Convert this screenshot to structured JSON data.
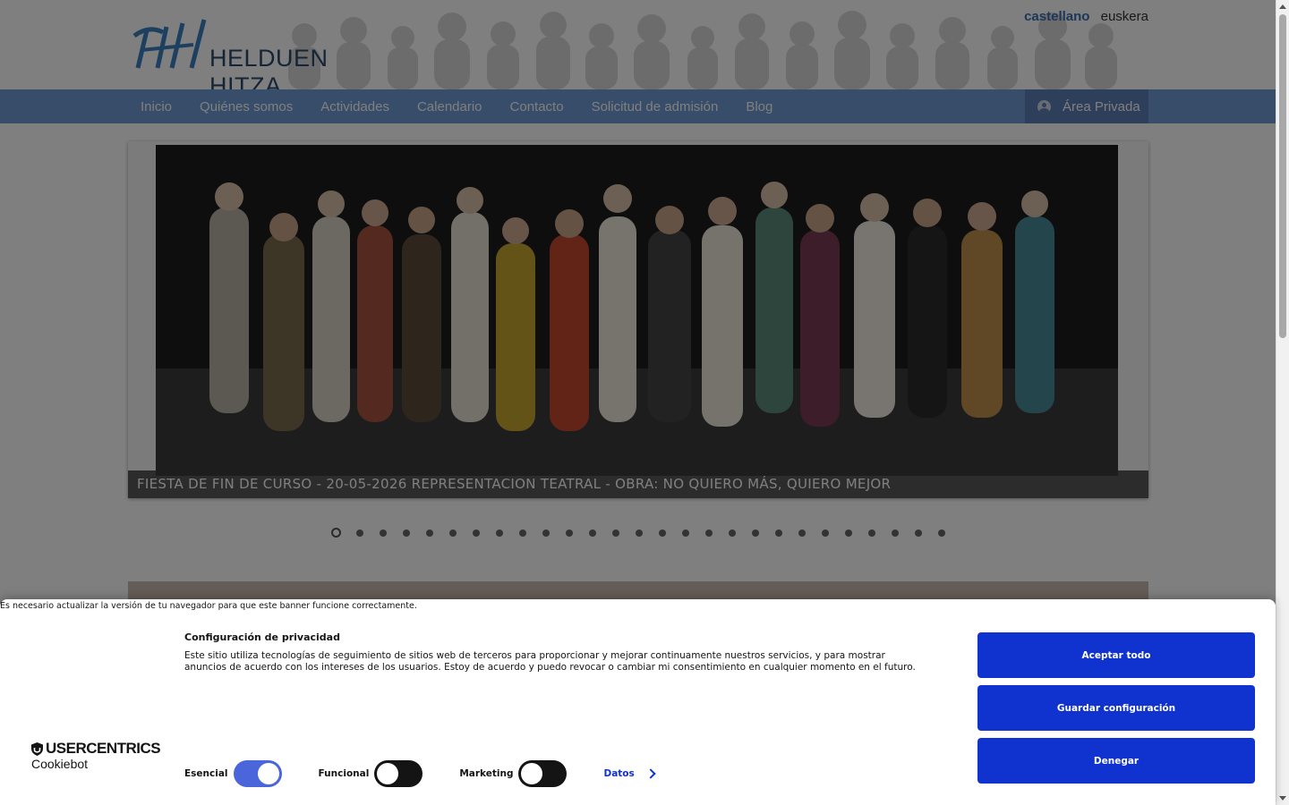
{
  "lang": {
    "active": "castellano",
    "other": "euskera"
  },
  "logo": {
    "text": "HELDUEN HITZA"
  },
  "nav": {
    "items": [
      "Inicio",
      "Quiénes somos",
      "Actividades",
      "Calendario",
      "Contacto",
      "Solicitud de admisión",
      "Blog"
    ],
    "private_label": "Área Privada"
  },
  "slider": {
    "caption": "FIESTA DE FIN DE CURSO - 20-05-2026 REPRESENTACION TEATRAL - OBRA: NO QUIERO MÁS, QUIERO MEJOR",
    "dot_count": 27,
    "active_index": 0
  },
  "cookie": {
    "browser_warning": "Es necesario actualizar la versión de tu navegador para que este banner funcione correctamente.",
    "brand": "USERCENTRICS",
    "brand_sub": "Cookiebot",
    "title": "Configuración de privacidad",
    "text": "Este sitio utiliza tecnologías de seguimiento de sitios web de terceros para proporcionar y mejorar continuamente nuestros servicios, y para mostrar anuncios de acuerdo con los intereses de los usuarios. Estoy de acuerdo y puedo revocar o cambiar mi consentimiento en cualquier momento en el futuro.",
    "toggles": [
      {
        "label": "Esencial",
        "on": true
      },
      {
        "label": "Funcional",
        "on": false
      },
      {
        "label": "Marketing",
        "on": false
      }
    ],
    "details_label": "Datos",
    "buttons": {
      "accept": "Aceptar todo",
      "save": "Guardar configuración",
      "deny": "Denegar"
    },
    "accent": "#1032cf"
  }
}
